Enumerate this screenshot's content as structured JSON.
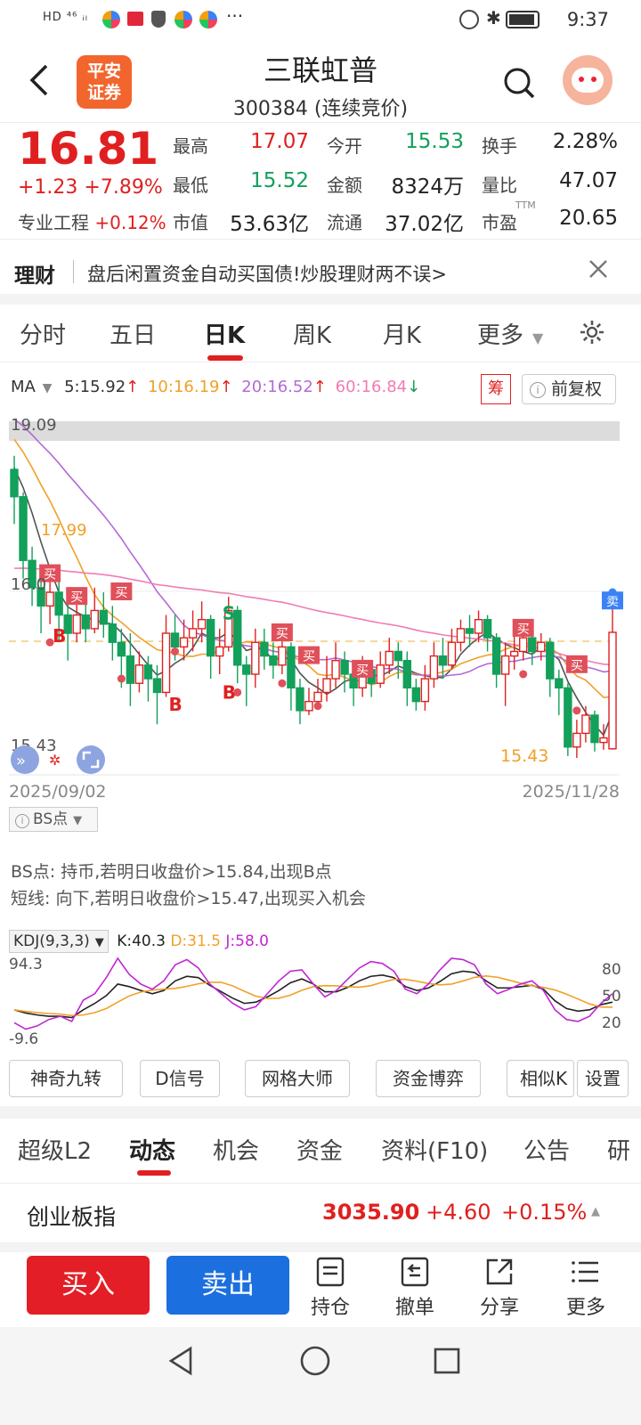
{
  "status": {
    "left": "HD ⁴⁶ ᵢₗ",
    "time": "9:37"
  },
  "header": {
    "logo": "平安证券",
    "title": "三联虹普",
    "subtitle": "300384 (连续竞价)"
  },
  "quote": {
    "price": "16.81",
    "change": "+1.23 +7.89%",
    "sector_label": "专业工程",
    "sector_change": "+0.12%",
    "fields": [
      {
        "label": "最高",
        "value": "17.07",
        "color": "red"
      },
      {
        "label": "今开",
        "value": "15.53",
        "color": "green"
      },
      {
        "label": "换手",
        "value": "2.28%",
        "color": "dark"
      },
      {
        "label": "最低",
        "value": "15.52",
        "color": "green"
      },
      {
        "label": "金额",
        "value": "8324万",
        "color": "dark"
      },
      {
        "label": "量比",
        "value": "47.07",
        "color": "dark"
      },
      {
        "label": "市值",
        "value": "53.63亿",
        "color": "dark"
      },
      {
        "label": "流通",
        "value": "37.02亿",
        "color": "dark"
      },
      {
        "label": "市盈",
        "value": "20.65",
        "color": "dark",
        "sup": "TTM"
      }
    ]
  },
  "banner": {
    "tag": "理财",
    "text": "盘后闲置资金自动买国债!炒股理财两不误>"
  },
  "chart_tabs": [
    "分时",
    "五日",
    "日K",
    "周K",
    "月K",
    "更多"
  ],
  "ma": {
    "label": "MA",
    "items": [
      {
        "text": "5:15.92",
        "arrow": "↑",
        "color": "#333"
      },
      {
        "text": "10:16.19",
        "arrow": "↑",
        "color": "#f0a028"
      },
      {
        "text": "20:16.52",
        "arrow": "↑",
        "color": "#b36ad6"
      },
      {
        "text": "60:16.84",
        "arrow": "↓",
        "color": "#f07cb4"
      }
    ]
  },
  "chip_label": "筹",
  "fq_label": "前复权",
  "chart_labels": {
    "high": "19.09",
    "low_left": "15.43",
    "low_mark": "15.43",
    "mark_1799": "17.99",
    "mid_level": "16.0"
  },
  "signals": {
    "buy": "买",
    "sell": "卖",
    "b": "B",
    "s": "S"
  },
  "dates": {
    "start": "2025/09/02",
    "end": "2025/11/28"
  },
  "bs": {
    "dropdown": "BS点",
    "line1": "BS点: 持币,若明日收盘价>15.84,出现B点",
    "line2": "短线: 向下,若明日收盘价>15.47,出现买入机会"
  },
  "kdj": {
    "label": "KDJ(9,3,3)",
    "k": "K:40.3",
    "d": "D:31.5",
    "j": "J:58.0",
    "top": "94.3",
    "bottom": "-9.6",
    "right": [
      "80",
      "50",
      "20"
    ]
  },
  "tools": [
    "神奇九转",
    "D信号",
    "网格大师",
    "资金博弈",
    "相似K",
    "设置"
  ],
  "bottom_tabs": [
    "超级L2",
    "动态",
    "机会",
    "资金",
    "资料(F10)",
    "公告",
    "研"
  ],
  "index": {
    "name": "创业板指",
    "value": "3035.90",
    "change": "+4.60",
    "pct": "+0.15%"
  },
  "actions": {
    "buy": "买入",
    "sell": "卖出",
    "items": [
      "持仓",
      "撤单",
      "分享",
      "更多"
    ]
  },
  "chart_data": {
    "type": "candlestick",
    "ylim": [
      15.43,
      19.09
    ],
    "x_range": [
      "2025/09/02",
      "2025/11/28"
    ],
    "candles": [
      [
        18.6,
        18.3,
        18.75,
        18.0
      ],
      [
        18.3,
        17.6,
        18.35,
        17.4
      ],
      [
        17.6,
        17.3,
        17.75,
        17.1
      ],
      [
        17.3,
        17.1,
        17.5,
        16.8
      ],
      [
        17.1,
        17.25,
        17.4,
        16.9
      ],
      [
        17.25,
        17.0,
        17.45,
        16.7
      ],
      [
        17.0,
        16.8,
        17.2,
        16.5
      ],
      [
        16.8,
        17.0,
        17.2,
        16.7
      ],
      [
        17.0,
        16.85,
        17.15,
        16.7
      ],
      [
        16.85,
        17.05,
        17.3,
        16.8
      ],
      [
        17.05,
        16.9,
        17.25,
        16.75
      ],
      [
        16.9,
        16.7,
        17.1,
        16.5
      ],
      [
        16.7,
        16.55,
        16.85,
        16.2
      ],
      [
        16.55,
        16.25,
        16.8,
        16.0
      ],
      [
        16.25,
        16.45,
        16.6,
        16.15
      ],
      [
        16.45,
        16.3,
        16.55,
        16.05
      ],
      [
        16.3,
        16.15,
        16.45,
        15.8
      ],
      [
        16.15,
        16.8,
        17.0,
        16.1
      ],
      [
        16.8,
        16.65,
        17.0,
        16.5
      ],
      [
        16.65,
        16.75,
        16.95,
        16.5
      ],
      [
        16.75,
        16.85,
        17.05,
        16.6
      ],
      [
        16.85,
        16.95,
        17.15,
        16.7
      ],
      [
        16.95,
        16.55,
        17.0,
        16.3
      ],
      [
        16.55,
        16.65,
        16.85,
        16.35
      ],
      [
        16.65,
        17.05,
        17.2,
        16.6
      ],
      [
        17.05,
        16.45,
        17.1,
        16.25
      ],
      [
        16.45,
        16.35,
        16.55,
        16.0
      ],
      [
        16.35,
        16.7,
        16.85,
        16.2
      ],
      [
        16.7,
        16.55,
        16.85,
        16.4
      ],
      [
        16.55,
        16.45,
        16.7,
        16.3
      ],
      [
        16.45,
        16.65,
        16.8,
        16.35
      ],
      [
        16.65,
        16.2,
        16.7,
        15.95
      ],
      [
        16.2,
        15.95,
        16.3,
        15.8
      ],
      [
        15.95,
        16.05,
        16.2,
        15.9
      ],
      [
        16.05,
        16.15,
        16.3,
        16.0
      ],
      [
        16.15,
        16.3,
        16.55,
        16.05
      ],
      [
        16.3,
        16.5,
        16.7,
        16.2
      ],
      [
        16.5,
        16.35,
        16.6,
        16.15
      ],
      [
        16.35,
        16.2,
        16.5,
        16.0
      ],
      [
        16.2,
        16.4,
        16.55,
        16.1
      ],
      [
        16.4,
        16.25,
        16.5,
        16.1
      ],
      [
        16.25,
        16.45,
        16.6,
        16.2
      ],
      [
        16.45,
        16.6,
        16.75,
        16.35
      ],
      [
        16.6,
        16.5,
        16.7,
        16.3
      ],
      [
        16.5,
        16.2,
        16.6,
        16.0
      ],
      [
        16.2,
        16.05,
        16.3,
        15.95
      ],
      [
        16.05,
        16.3,
        16.45,
        15.95
      ],
      [
        16.3,
        16.55,
        16.7,
        16.2
      ],
      [
        16.55,
        16.45,
        16.75,
        16.3
      ],
      [
        16.45,
        16.7,
        16.85,
        16.4
      ],
      [
        16.7,
        16.85,
        16.95,
        16.6
      ],
      [
        16.85,
        16.8,
        17.0,
        16.65
      ],
      [
        16.8,
        16.95,
        17.05,
        16.7
      ],
      [
        16.95,
        16.75,
        17.0,
        16.6
      ],
      [
        16.75,
        16.35,
        16.8,
        16.2
      ],
      [
        16.35,
        16.55,
        16.7,
        16.0
      ],
      [
        16.55,
        16.6,
        16.8,
        16.4
      ],
      [
        16.6,
        16.75,
        16.85,
        16.5
      ],
      [
        16.75,
        16.6,
        16.85,
        16.45
      ],
      [
        16.6,
        16.7,
        16.8,
        16.5
      ],
      [
        16.7,
        16.3,
        16.75,
        16.1
      ],
      [
        16.3,
        16.2,
        16.4,
        15.9
      ],
      [
        16.2,
        15.55,
        16.25,
        15.45
      ],
      [
        15.55,
        15.7,
        15.85,
        15.43
      ],
      [
        15.7,
        15.9,
        16.0,
        15.6
      ],
      [
        15.9,
        15.6,
        15.95,
        15.5
      ],
      [
        15.6,
        15.65,
        15.8,
        15.52
      ],
      [
        15.53,
        16.81,
        17.07,
        15.52
      ]
    ]
  }
}
